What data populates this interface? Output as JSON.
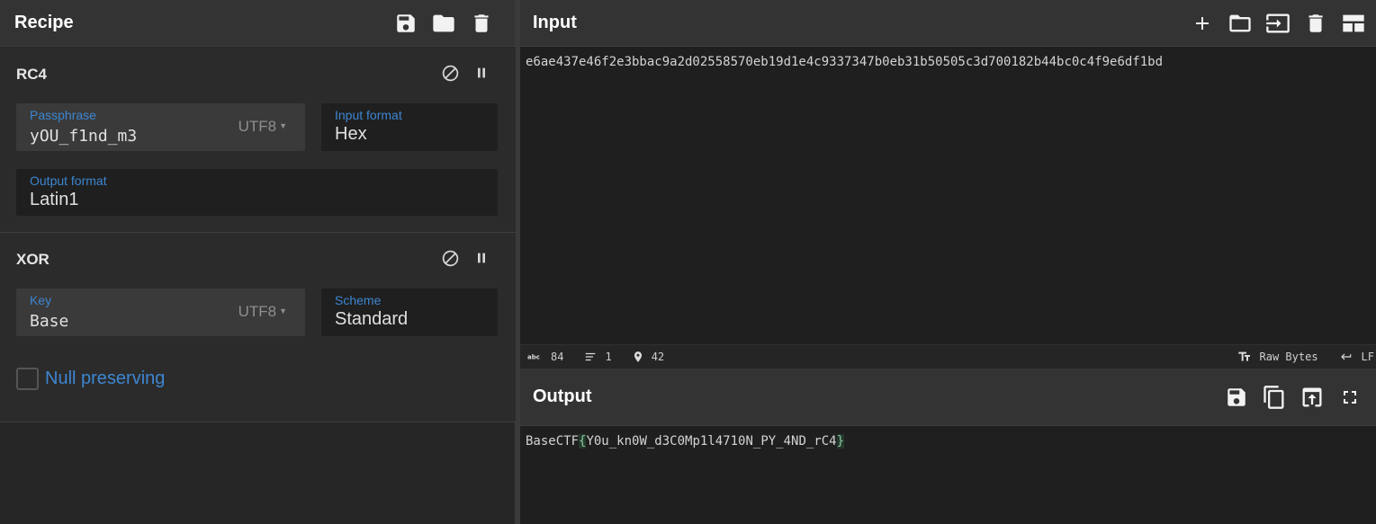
{
  "recipe": {
    "title": "Recipe",
    "header_icons": [
      "save-icon",
      "folder-icon",
      "trash-icon"
    ],
    "operations": [
      {
        "name": "RC4",
        "passphrase": {
          "label": "Passphrase",
          "value": "yOU_f1nd_m3",
          "encoding": "UTF8"
        },
        "input_format": {
          "label": "Input format",
          "value": "Hex"
        },
        "output_format": {
          "label": "Output format",
          "value": "Latin1"
        }
      },
      {
        "name": "XOR",
        "key": {
          "label": "Key",
          "value": "Base",
          "encoding": "UTF8"
        },
        "scheme": {
          "label": "Scheme",
          "value": "Standard"
        },
        "null_preserving": {
          "label": "Null preserving",
          "checked": false
        }
      }
    ]
  },
  "input": {
    "title": "Input",
    "text": "e6ae437e46f2e3bbac9a2d02558570eb19d1e4c9337347b0eb31b50505c3d700182b44bc0c4f9e6df1bd",
    "status": {
      "length": "84",
      "lines": "1",
      "position": "42",
      "raw_bytes_label": "Raw Bytes",
      "eol_label": "LF"
    }
  },
  "output": {
    "title": "Output",
    "text_prefix": "BaseCTF",
    "open_brace": "{",
    "text_inner": "Y0u_kn0W_d3C0Mp1l4710N_PY_4ND_rC4",
    "close_brace": "}"
  },
  "colors": {
    "accent": "#3d86d1",
    "background": "#1e1e1e",
    "panel": "#2b2b2b"
  }
}
